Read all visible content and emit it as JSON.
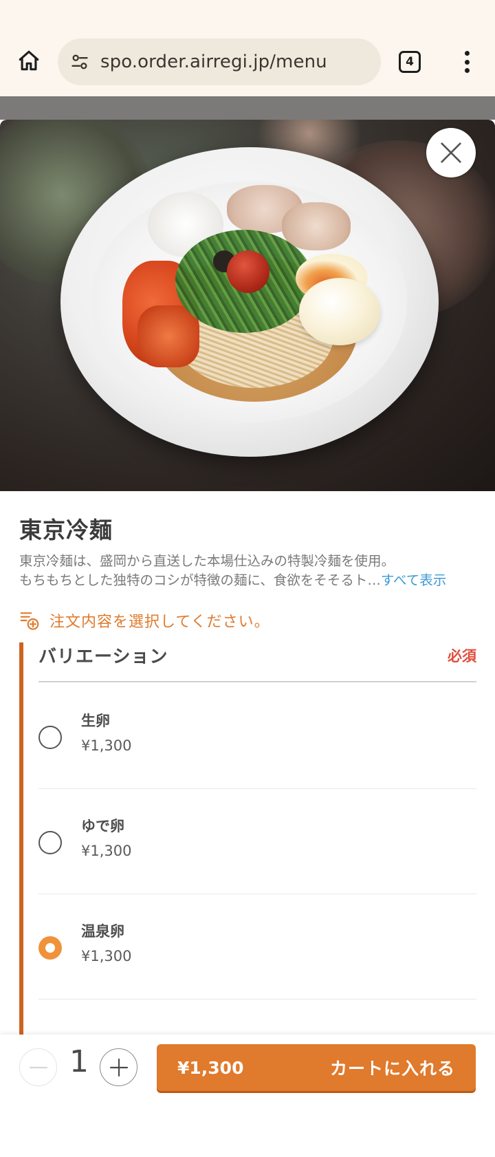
{
  "browser": {
    "url": "spo.order.airregi.jp/menu",
    "tab_count": "4",
    "icons": [
      "home-icon",
      "site-settings-icon",
      "tabs-icon",
      "more-vert-icon"
    ]
  },
  "hero": {
    "image_alt": "東京冷麺",
    "close_icon": "close-icon"
  },
  "item": {
    "title": "東京冷麺",
    "description_line1": "東京冷麺は、盛岡から直送した本場仕込みの特製冷麺を使用。",
    "description_line2": "もちもちとした独特のコシが特徴の麺に、食欲をそそるト…",
    "show_all": "すべて表示"
  },
  "notice": {
    "text": "注文内容を選択してください。",
    "icon": "list-add-icon",
    "color": "#e07a2c"
  },
  "variation": {
    "title": "バリエーション",
    "required_label": "必須",
    "options": [
      {
        "name": "生卵",
        "price": "¥1,300",
        "selected": false
      },
      {
        "name": "ゆで卵",
        "price": "¥1,300",
        "selected": false
      },
      {
        "name": "温泉卵",
        "price": "¥1,300",
        "selected": true
      }
    ]
  },
  "order": {
    "quantity": "1",
    "price": "¥1,300",
    "add_to_cart_label": "カートに入れる",
    "accent_color": "#e07a2c"
  }
}
